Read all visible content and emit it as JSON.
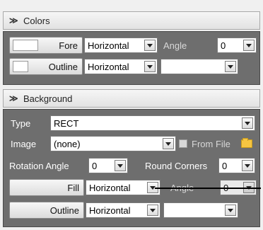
{
  "colors_section": {
    "title": "Colors",
    "fore": {
      "label": "Fore",
      "direction": "Horizontal",
      "angle_label": "Angle",
      "angle_value": "0"
    },
    "outline": {
      "label": "Outline",
      "direction": "Horizontal",
      "extra_value": ""
    }
  },
  "background_section": {
    "title": "Background",
    "type": {
      "label": "Type",
      "value": "RECT"
    },
    "image": {
      "label": "Image",
      "value": "(none)",
      "from_file_label": "From File"
    },
    "rotation": {
      "label": "Rotation Angle",
      "value": "0"
    },
    "round_corners": {
      "label": "Round Corners",
      "value": "0"
    },
    "fill": {
      "label": "Fill",
      "direction": "Horizontal",
      "angle_label": "Angle",
      "angle_value": "0"
    },
    "outline": {
      "label": "Outline",
      "direction": "Horizontal",
      "extra_value": ""
    }
  },
  "icons": {
    "collapse": "chevron-double-up-icon",
    "folder": "folder-icon",
    "dropdown": "chevron-down-icon"
  }
}
